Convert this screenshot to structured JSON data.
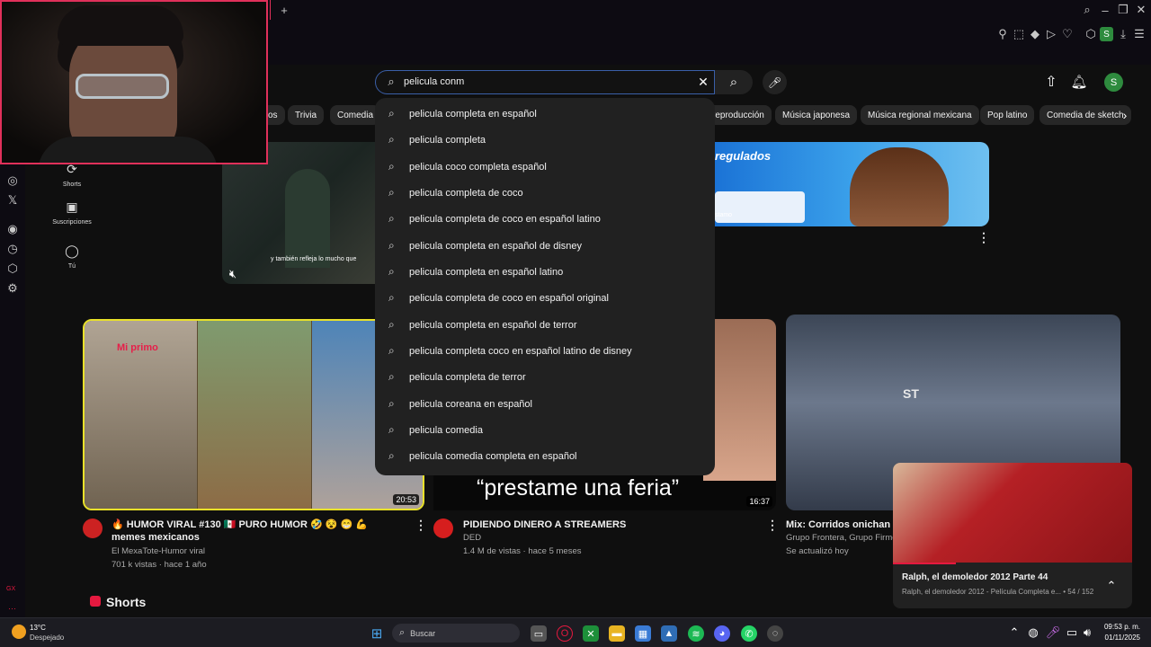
{
  "search": {
    "value": "pelicula conm",
    "suggestions": [
      "pelicula completa en español",
      "pelicula completa",
      "pelicula coco completa español",
      "pelicula completa de coco",
      "pelicula completa de coco en español latino",
      "pelicula completa en español de disney",
      "pelicula completa en español latino",
      "pelicula completa de coco en español original",
      "pelicula completa en español de terror",
      "pelicula completa coco en español latino de disney",
      "pelicula completa de terror",
      "pelicula coreana en español",
      "pelicula comedia",
      "pelicula comedia completa en español"
    ]
  },
  "header": {
    "avatar_letter": "S"
  },
  "browser": {
    "profile_letter": "S"
  },
  "chips": [
    "Trivia",
    "Comedia",
    "reproducción",
    "Música japonesa",
    "Música regional mexicana",
    "Pop latino",
    "Comedia de sketch"
  ],
  "nav": {
    "shorts": "Shorts",
    "subs": "Suscripciones",
    "you": "Tú"
  },
  "gx": {
    "label": "GX"
  },
  "featured": {
    "caption": "y también refleja lo mucho que",
    "banner_text": "regulados",
    "banner_sub": "stamo"
  },
  "videos": [
    {
      "title": "🔥 HUMOR VIRAL #130 🇲🇽 PURO HUMOR 🤣 😵 😁 💪 memes mexicanos",
      "channel": "El MexaTote-Humor viral",
      "meta": "701 k vistas · hace 1 año",
      "duration": "20:53",
      "overlay": "Mi primo"
    },
    {
      "title": "PIDIENDO DINERO A STREAMERS",
      "channel": "DED",
      "meta": "1.4 M de vistas · hace 5 meses",
      "duration": "16:37",
      "overlay": "“prestame una feria”"
    },
    {
      "title": "Mix: Corridos onichan La",
      "channel": "Grupo Frontera, Grupo Firme,",
      "meta": "Se actualizó hoy",
      "overlay": "ST"
    }
  ],
  "miniplayer": {
    "title": "Ralph, el demoledor 2012 Parte 44",
    "subtitle": "Ralph, el demoledor 2012 - Película Completa e...",
    "position": "54 / 152"
  },
  "shorts_heading": "Shorts",
  "taskbar": {
    "temp": "13°C",
    "weather": "Despejado",
    "search_placeholder": "Buscar",
    "time": "09:53 p. m.",
    "date": "01/11/2025"
  },
  "colors": {
    "accent": "#e5193f",
    "search_border": "#3a5fa8",
    "avatar_green": "#2e8b3e"
  }
}
